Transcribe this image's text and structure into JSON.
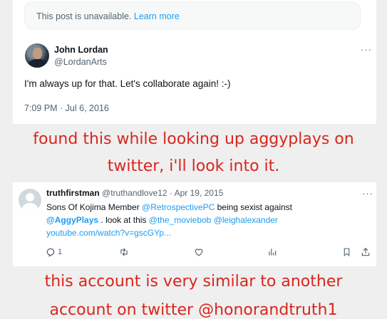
{
  "post1": {
    "unavailable_text": "This post is unavailable.",
    "unavailable_link": "Learn more",
    "author_name": "John Lordan",
    "author_handle": "@LordanArts",
    "more": "···",
    "text": "I'm always up for that.  Let's collaborate again!  :-)",
    "timestamp": "7:09 PM · Jul 6, 2016"
  },
  "caption1": {
    "line1": "found this while looking up aggyplays on",
    "line2": "twitter, i'll look into it."
  },
  "post2": {
    "author_name": "truthfirstman",
    "author_handle": "@truthandlove12",
    "separator": " · ",
    "date": "Apr 19, 2015",
    "more": "···",
    "line1_a": "Sons Of Kojima Member ",
    "line1_mention": "@RetrospectivePC",
    "line1_b": " being sexist against",
    "line2_mention": "@AggyPlays",
    "line2_a": " . look at this ",
    "line2_mention2": "@the_moviebob",
    "line2_space": " ",
    "line2_mention3": "@leighalexander",
    "line3_link": "youtube.com/watch?v=gscGYp...",
    "reply_count": "1"
  },
  "caption2": {
    "line1": "this account is very similar to another",
    "line2": "account on twitter @honorandtruth1"
  },
  "colors": {
    "caption": "#d8261d",
    "link": "#1d9bf0",
    "muted": "#536471",
    "text": "#0f1419"
  },
  "icons": [
    "reply-icon",
    "retweet-icon",
    "like-icon",
    "views-icon",
    "bookmark-icon",
    "share-icon"
  ]
}
